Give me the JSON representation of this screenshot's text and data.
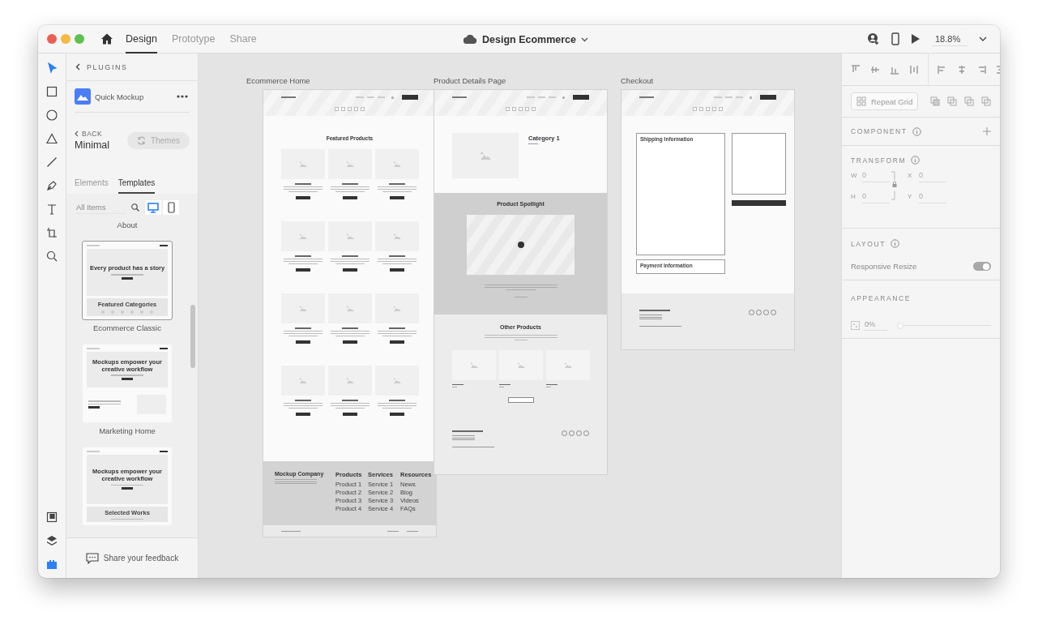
{
  "titlebar": {
    "tabs": [
      {
        "label": "Design",
        "selected": true
      },
      {
        "label": "Prototype",
        "selected": false
      },
      {
        "label": "Share",
        "selected": false
      }
    ],
    "document_title": "Design Ecommerce",
    "zoom": "18.8%"
  },
  "tools": [
    {
      "kind": "select",
      "selected": true
    },
    {
      "kind": "rectangle",
      "selected": false
    },
    {
      "kind": "ellipse",
      "selected": false
    },
    {
      "kind": "polygon",
      "selected": false
    },
    {
      "kind": "line",
      "selected": false
    },
    {
      "kind": "pen",
      "selected": false
    },
    {
      "kind": "text",
      "selected": false
    },
    {
      "kind": "artboard",
      "selected": false
    },
    {
      "kind": "zoom",
      "selected": false
    }
  ],
  "bottom_tools": [
    {
      "kind": "assets",
      "selected": false
    },
    {
      "kind": "layers",
      "selected": false
    },
    {
      "kind": "plugins",
      "selected": true
    }
  ],
  "plugin_panel": {
    "header": "PLUGINS",
    "plugin_name": "Quick Mockup",
    "back": "BACK",
    "theme_name": "Minimal",
    "themes_button": "Themes",
    "tabs": [
      {
        "label": "Elements",
        "selected": false
      },
      {
        "label": "Templates",
        "selected": true
      }
    ],
    "search_placeholder": "All Items",
    "devices": [
      {
        "kind": "desktop",
        "selected": true
      },
      {
        "kind": "mobile",
        "selected": false
      }
    ],
    "scrolled_label": "About",
    "templates": [
      {
        "kind": "ecommerce",
        "name": "Ecommerce Classic",
        "selected": true,
        "headline": "Every product has a story",
        "section": "Featured Categories"
      },
      {
        "kind": "marketing",
        "name": "Marketing Home",
        "selected": false,
        "headline": "Mockups empower your creative workflow"
      },
      {
        "kind": "portfolio",
        "selected": false,
        "headline": "Mockups empower your creative workflow",
        "section": "Selected Works"
      }
    ],
    "feedback": "Share your feedback"
  },
  "artboards": [
    {
      "kind": "home",
      "title": "Ecommerce Home",
      "section_title": "Featured Products",
      "footer": {
        "company": "Mockup Company",
        "columns": [
          {
            "heading": "Products",
            "links": [
              "Product 1",
              "Product 2",
              "Product 3",
              "Product 4"
            ]
          },
          {
            "heading": "Services",
            "links": [
              "Service 1",
              "Service 2",
              "Service 3",
              "Service 4"
            ]
          },
          {
            "heading": "Resources",
            "links": [
              "News",
              "Blog",
              "Videos",
              "FAQs"
            ]
          }
        ]
      }
    },
    {
      "kind": "product",
      "title": "Product Details Page",
      "category": "Category 1",
      "spotlight_title": "Product Spotlight",
      "other_title": "Other Products"
    },
    {
      "kind": "checkout",
      "title": "Checkout",
      "shipping": "Shipping Information",
      "payment": "Payment Information"
    }
  ],
  "properties": {
    "repeat_grid": "Repeat Grid",
    "component_label": "COMPONENT",
    "transform_label": "TRANSFORM",
    "fields": [
      {
        "label": "W",
        "value": "0"
      },
      {
        "label": "X",
        "value": "0"
      },
      {
        "label": "H",
        "value": "0"
      },
      {
        "label": "Y",
        "value": "0"
      }
    ],
    "layout_label": "LAYOUT",
    "responsive_resize": {
      "label": "Responsive Resize",
      "on": true
    },
    "appearance_label": "APPEARANCE",
    "opacity": {
      "value": "0%",
      "level": 0
    }
  }
}
